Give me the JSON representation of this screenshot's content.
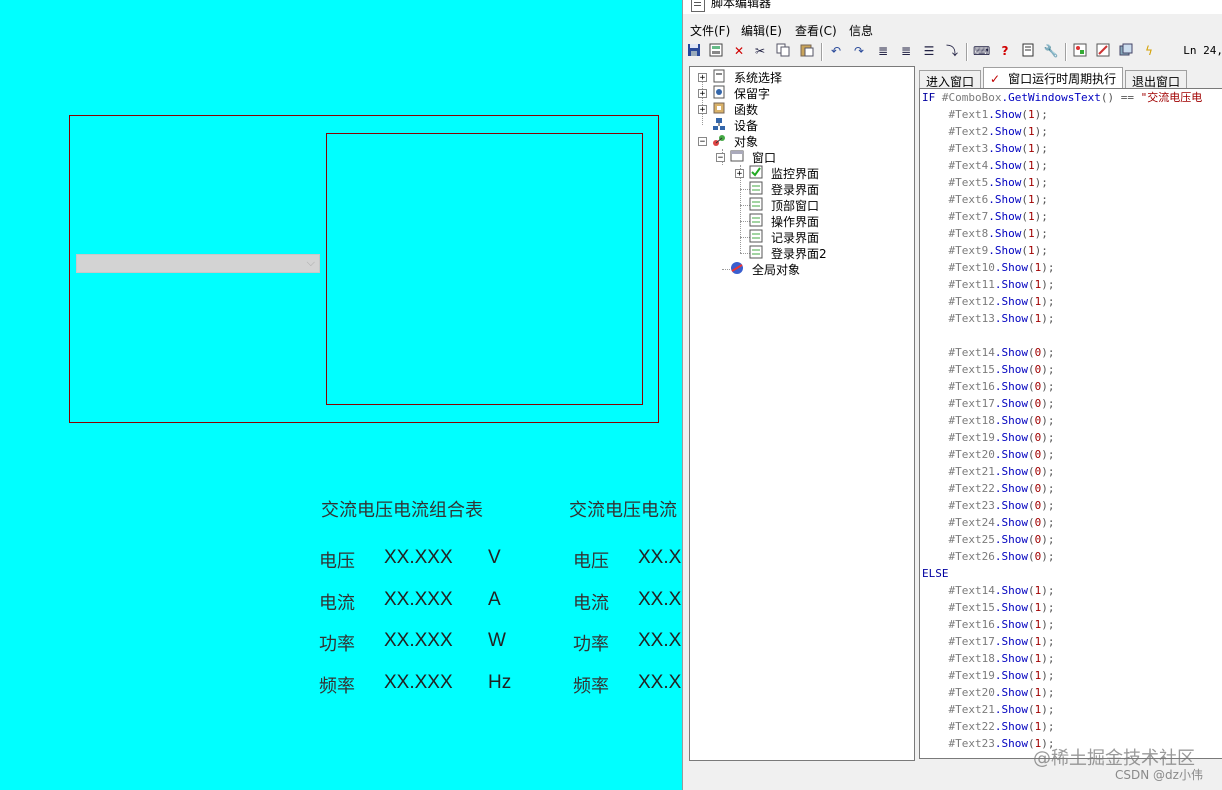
{
  "canvas": {
    "combo_arrow": "⌵",
    "meters": [
      {
        "title": "交流电压电流组合表",
        "rows": [
          {
            "label": "电压",
            "value": "XX.XXX",
            "unit": "V"
          },
          {
            "label": "电流",
            "value": "XX.XXX",
            "unit": "A"
          },
          {
            "label": "功率",
            "value": "XX.XXX",
            "unit": "W"
          },
          {
            "label": "频率",
            "value": "XX.XXX",
            "unit": "Hz"
          }
        ]
      },
      {
        "title": "交流电压电流",
        "rows": [
          {
            "label": "电压",
            "value": "XX.X"
          },
          {
            "label": "电流",
            "value": "XX.X"
          },
          {
            "label": "功率",
            "value": "XX.X"
          },
          {
            "label": "频率",
            "value": "XX.X"
          }
        ]
      }
    ]
  },
  "editor": {
    "title": "脚本编辑器",
    "menu": [
      "文件(F)",
      "编辑(E)",
      "查看(C)",
      "信息"
    ],
    "toolbar_icons": [
      "save-icon",
      "save-all-icon",
      "delete-icon",
      "cut-icon",
      "copy-icon",
      "paste-icon",
      "undo-icon",
      "redo-icon",
      "indent-icon",
      "outdent-icon",
      "align-icon",
      "comment-icon",
      "keyboard-icon",
      "help-icon",
      "book-icon",
      "wrench-icon",
      "image-icon",
      "edit-icon",
      "window-icon",
      "lightning-icon"
    ],
    "line_indicator": "Ln 24,",
    "tree": [
      "系统选择",
      "保留字",
      "函数",
      "设备",
      "对象",
      "窗口",
      "监控界面",
      "登录界面",
      "顶部窗口",
      "操作界面",
      "记录界面",
      "登录界面2",
      "全局对象"
    ],
    "tabs": [
      "进入窗口",
      "窗口运行时周期执行",
      "退出窗口"
    ],
    "tab_check": "✓",
    "code": {
      "if_kw": "IF",
      "if_obj": "#ComboBox",
      "if_fn": ".GetWindowsText",
      "if_rest": "() == ",
      "if_str": "\"交流电压电",
      "else_kw": "ELSE",
      "lines": [
        {
          "obj": "#Text1",
          "arg": "1"
        },
        {
          "obj": "#Text2",
          "arg": "1"
        },
        {
          "obj": "#Text3",
          "arg": "1"
        },
        {
          "obj": "#Text4",
          "arg": "1"
        },
        {
          "obj": "#Text5",
          "arg": "1"
        },
        {
          "obj": "#Text6",
          "arg": "1"
        },
        {
          "obj": "#Text7",
          "arg": "1"
        },
        {
          "obj": "#Text8",
          "arg": "1"
        },
        {
          "obj": "#Text9",
          "arg": "1"
        },
        {
          "obj": "#Text10",
          "arg": "1"
        },
        {
          "obj": "#Text11",
          "arg": "1"
        },
        {
          "obj": "#Text12",
          "arg": "1"
        },
        {
          "obj": "#Text13",
          "arg": "1"
        },
        {
          "obj": "",
          "arg": ""
        },
        {
          "obj": "#Text14",
          "arg": "0"
        },
        {
          "obj": "#Text15",
          "arg": "0"
        },
        {
          "obj": "#Text16",
          "arg": "0"
        },
        {
          "obj": "#Text17",
          "arg": "0"
        },
        {
          "obj": "#Text18",
          "arg": "0"
        },
        {
          "obj": "#Text19",
          "arg": "0"
        },
        {
          "obj": "#Text20",
          "arg": "0"
        },
        {
          "obj": "#Text21",
          "arg": "0"
        },
        {
          "obj": "#Text22",
          "arg": "0"
        },
        {
          "obj": "#Text23",
          "arg": "0"
        },
        {
          "obj": "#Text24",
          "arg": "0"
        },
        {
          "obj": "#Text25",
          "arg": "0"
        },
        {
          "obj": "#Text26",
          "arg": "0"
        }
      ],
      "else_lines": [
        {
          "obj": "#Text14",
          "arg": "1"
        },
        {
          "obj": "#Text15",
          "arg": "1"
        },
        {
          "obj": "#Text16",
          "arg": "1"
        },
        {
          "obj": "#Text17",
          "arg": "1"
        },
        {
          "obj": "#Text18",
          "arg": "1"
        },
        {
          "obj": "#Text19",
          "arg": "1"
        },
        {
          "obj": "#Text20",
          "arg": "1"
        },
        {
          "obj": "#Text21",
          "arg": "1"
        },
        {
          "obj": "#Text22",
          "arg": "1"
        },
        {
          "obj": "#Text23",
          "arg": "1"
        }
      ],
      "show_fn": ".Show",
      "suffix": ";"
    }
  },
  "watermark": {
    "main": "@稀土掘金技术社区",
    "sub": "CSDN @dz小伟"
  }
}
